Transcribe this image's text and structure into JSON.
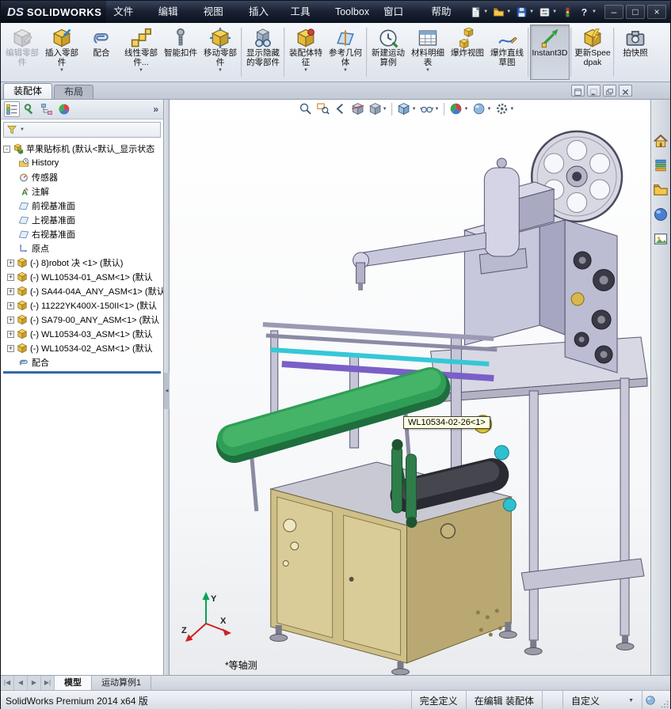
{
  "window": {
    "logo_ds": "DS",
    "logo_text": "SOLIDWORKS",
    "controls": {
      "minimize": "–",
      "maximize": "□",
      "close": "×"
    }
  },
  "icons": {
    "caret": "▼",
    "chevrons": "»",
    "collapse": "◀",
    "plus": "+",
    "minus": "-"
  },
  "menu": {
    "items": [
      {
        "name": "file",
        "label": "文件(F)"
      },
      {
        "name": "edit",
        "label": "编辑(E)"
      },
      {
        "name": "view",
        "label": "视图(V)"
      },
      {
        "name": "insert",
        "label": "插入(I)"
      },
      {
        "name": "tools",
        "label": "工具(T)"
      },
      {
        "name": "toolbox",
        "label": "Toolbox"
      },
      {
        "name": "window",
        "label": "窗口(W)"
      },
      {
        "name": "help",
        "label": "帮助(H)"
      }
    ]
  },
  "quickbar": {
    "items": [
      {
        "name": "new-document",
        "icon": "page",
        "arrow": true
      },
      {
        "name": "open-document",
        "icon": "folder",
        "arrow": true
      },
      {
        "name": "save-document",
        "icon": "floppy",
        "arrow": true
      },
      {
        "name": "options",
        "icon": "options",
        "arrow": true
      },
      {
        "name": "rebuild",
        "icon": "traffic"
      },
      {
        "name": "help",
        "icon": "help",
        "arrow": true
      }
    ]
  },
  "toolbar": {
    "buttons": [
      {
        "name": "edit-component",
        "icon": "t-edit",
        "label": "编辑零部件",
        "disabled": true
      },
      {
        "name": "insert-component",
        "icon": "t-insert",
        "label": "插入零部件",
        "arrow": true
      },
      {
        "name": "mate",
        "icon": "t-mate",
        "label": "配合"
      },
      {
        "name": "linear-component-pattern",
        "icon": "t-linear",
        "label": "线性零部件...",
        "arrow": true
      },
      {
        "name": "smart-fasteners",
        "icon": "t-fastener",
        "label": "智能扣件"
      },
      {
        "name": "move-component",
        "icon": "t-move",
        "label": "移动零部件",
        "arrow": true
      },
      {
        "sep": true
      },
      {
        "name": "show-hidden-components",
        "icon": "t-showhide",
        "label": "显示隐藏的零部件"
      },
      {
        "sep": true
      },
      {
        "name": "assembly-features",
        "icon": "t-feature",
        "label": "装配体特征",
        "arrow": true
      },
      {
        "name": "reference-geometry",
        "icon": "t-refgeo",
        "label": "参考几何体",
        "arrow": true
      },
      {
        "sep": true
      },
      {
        "name": "new-motion-study",
        "icon": "t-motion",
        "label": "新建运动算例"
      },
      {
        "name": "bill-of-materials",
        "icon": "t-bom",
        "label": "材料明细表",
        "arrow": true
      },
      {
        "name": "exploded-view",
        "icon": "t-explode",
        "label": "爆炸视图"
      },
      {
        "name": "explode-line-sketch",
        "icon": "t-sketch",
        "label": "爆炸直线草图"
      },
      {
        "sep": true
      },
      {
        "name": "instant3d",
        "icon": "t-instant3d",
        "label": "Instant3D",
        "active": true
      },
      {
        "sep": true
      },
      {
        "name": "update-speedpak",
        "icon": "t-speedpak",
        "label": "更新Speedpak"
      },
      {
        "sep": true
      },
      {
        "name": "take-snapshot",
        "icon": "t-snapshot",
        "label": "拍快照"
      }
    ]
  },
  "cm_tabs": {
    "tabs": [
      {
        "name": "assembly",
        "label": "装配体",
        "active": true
      },
      {
        "name": "layout",
        "label": "布局",
        "active": false
      }
    ]
  },
  "doc_controls": {
    "items": [
      {
        "name": "doc-restore",
        "icon": "win-restore"
      },
      {
        "name": "doc-minimize",
        "icon": "win-min"
      },
      {
        "name": "doc-cascade",
        "icon": "win-cascade"
      },
      {
        "name": "doc-close",
        "icon": "win-close"
      }
    ]
  },
  "panel": {
    "tabs": [
      {
        "name": "featuremanager",
        "icon": "ft-tab",
        "active": true
      },
      {
        "name": "propertymanager",
        "icon": "pm-tab",
        "active": false
      },
      {
        "name": "configurationmanager",
        "icon": "cfg-tab",
        "active": false
      },
      {
        "name": "displaymanager",
        "icon": "dm-tab",
        "active": false
      }
    ],
    "tree": {
      "root_label": "苹果贴标机 (默认<默认_显示状态",
      "items": [
        {
          "icon": "history",
          "label": "History"
        },
        {
          "icon": "sensors",
          "label": "传感器"
        },
        {
          "icon": "annotations",
          "label": "注解"
        },
        {
          "icon": "plane",
          "label": "前视基准面"
        },
        {
          "icon": "plane",
          "label": "上视基准面"
        },
        {
          "icon": "plane",
          "label": "右视基准面"
        },
        {
          "icon": "origin",
          "label": "原点"
        },
        {
          "icon": "component",
          "label": "(-) 8)robot 决 <1> (默认)",
          "expand": true
        },
        {
          "icon": "component",
          "label": "(-) WL10534-01_ASM<1> (默认",
          "expand": true
        },
        {
          "icon": "component",
          "label": "(-) SA44-04A_ANY_ASM<1> (默认",
          "expand": true
        },
        {
          "icon": "component",
          "label": "(-) 11222YK400X-150II<1> (默认",
          "expand": true
        },
        {
          "icon": "component",
          "label": "(-) SA79-00_ANY_ASM<1> (默认",
          "expand": true
        },
        {
          "icon": "component",
          "label": "(-) WL10534-03_ASM<1> (默认",
          "expand": true
        },
        {
          "icon": "component",
          "label": "(-) WL10534-02_ASM<1> (默认",
          "expand": true
        },
        {
          "icon": "mates",
          "label": "配合"
        }
      ]
    }
  },
  "headsup": {
    "items": [
      {
        "name": "zoom-fit",
        "icon": "zoom-fit"
      },
      {
        "name": "zoom-area",
        "icon": "zoom-area"
      },
      {
        "name": "previous-view",
        "icon": "prev-view"
      },
      {
        "name": "section-view",
        "icon": "section"
      },
      {
        "name": "view-orientation",
        "icon": "orient",
        "arrow": true
      },
      {
        "sep": true
      },
      {
        "name": "display-style",
        "icon": "dispstyle",
        "arrow": true
      },
      {
        "name": "hide-show-items",
        "icon": "glasses",
        "arrow": true
      },
      {
        "sep": true
      },
      {
        "name": "edit-appearance",
        "icon": "appearance",
        "arrow": true
      },
      {
        "name": "apply-scene",
        "icon": "scene",
        "arrow": true
      },
      {
        "name": "view-settings",
        "icon": "settings",
        "arrow": true
      }
    ]
  },
  "taskpane": {
    "items": [
      {
        "name": "solidworks-resources",
        "icon": "home"
      },
      {
        "name": "design-library",
        "icon": "library"
      },
      {
        "name": "file-explorer",
        "icon": "explorer"
      },
      {
        "name": "appearances-scenes",
        "icon": "sphere"
      },
      {
        "name": "view-palette",
        "icon": "palette"
      }
    ]
  },
  "viewport": {
    "tooltip": "WL10534-02-26<1>",
    "view_label": "*等轴测",
    "triad": {
      "x": "X",
      "y": "Y",
      "z": "Z"
    }
  },
  "model_tabs": {
    "nav": [
      "|◀",
      "◀",
      "▶",
      "▶|"
    ],
    "tabs": [
      {
        "name": "model",
        "label": "模型",
        "active": true
      },
      {
        "name": "motion-study-1",
        "label": "运动算例1",
        "active": false
      }
    ]
  },
  "statusbar": {
    "left": "SolidWorks Premium 2014 x64 版",
    "define_state": "完全定义",
    "editing_state": "在编辑 装配体",
    "custom": "自定义"
  }
}
